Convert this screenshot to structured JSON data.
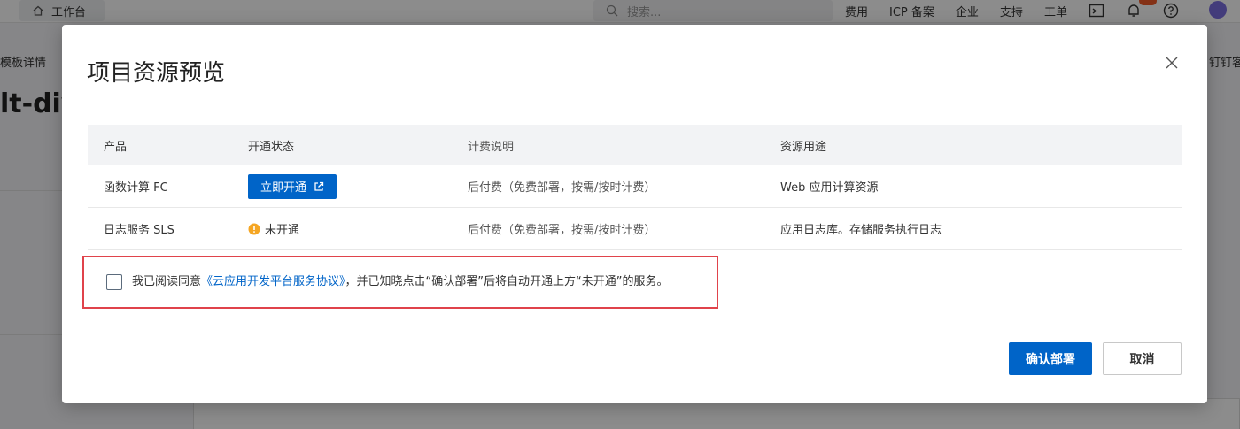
{
  "background": {
    "workbench_label": "工作台",
    "search_placeholder": "搜索...",
    "nav": [
      "费用",
      "ICP 备案",
      "企业",
      "支持",
      "工单"
    ],
    "breadcrumb_left": "模板详情",
    "breadcrumb_right": "钉钉客",
    "title_fragment": "lt-diy"
  },
  "dialog": {
    "title": "项目资源预览",
    "table": {
      "headers": [
        "产品",
        "开通状态",
        "计费说明",
        "资源用途"
      ],
      "rows": [
        {
          "product": "函数计算 FC",
          "status_button": "立即开通",
          "billing": "后付费（免费部署，按需/按时计费）",
          "usage": "Web 应用计算资源"
        },
        {
          "product": "日志服务 SLS",
          "status_text": "未开通",
          "billing": "后付费（免费部署，按需/按时计费）",
          "usage": "应用日志库。存储服务执行日志"
        }
      ]
    },
    "agreement": {
      "prefix": "我已阅读同意",
      "link": "《云应用开发平台服务协议》",
      "suffix": "，并已知晓点击“确认部署”后将自动开通上方“未开通”的服务。",
      "checked": false
    },
    "confirm_label": "确认部署",
    "cancel_label": "取消"
  },
  "colors": {
    "primary": "#0064c8",
    "warning": "#f5a623",
    "highlight_border": "#e0434b"
  }
}
